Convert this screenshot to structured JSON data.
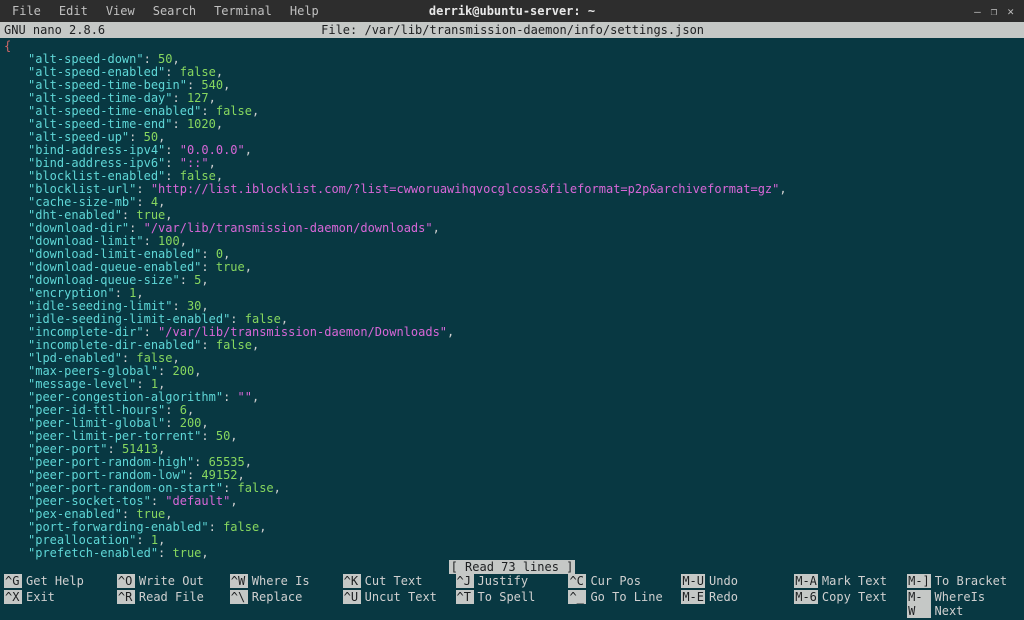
{
  "window": {
    "title": "derrik@ubuntu-server: ~",
    "menu": [
      "File",
      "Edit",
      "View",
      "Search",
      "Terminal",
      "Help"
    ]
  },
  "nano": {
    "app_title": "GNU nano 2.8.6",
    "file_label": "File: /var/lib/transmission-daemon/info/settings.json",
    "status": "[ Read 73 lines ]"
  },
  "json_lines": [
    {
      "k": "alt-speed-down",
      "t": "num",
      "v": "50"
    },
    {
      "k": "alt-speed-enabled",
      "t": "bool",
      "v": "false"
    },
    {
      "k": "alt-speed-time-begin",
      "t": "num",
      "v": "540"
    },
    {
      "k": "alt-speed-time-day",
      "t": "num",
      "v": "127"
    },
    {
      "k": "alt-speed-time-enabled",
      "t": "bool",
      "v": "false"
    },
    {
      "k": "alt-speed-time-end",
      "t": "num",
      "v": "1020"
    },
    {
      "k": "alt-speed-up",
      "t": "num",
      "v": "50"
    },
    {
      "k": "bind-address-ipv4",
      "t": "str",
      "v": "0.0.0.0"
    },
    {
      "k": "bind-address-ipv6",
      "t": "str",
      "v": "::"
    },
    {
      "k": "blocklist-enabled",
      "t": "bool",
      "v": "false"
    },
    {
      "k": "blocklist-url",
      "t": "str",
      "v": "http://list.iblocklist.com/?list=cwworuawihqvocglcoss&fileformat=p2p&archiveformat=gz"
    },
    {
      "k": "cache-size-mb",
      "t": "num",
      "v": "4"
    },
    {
      "k": "dht-enabled",
      "t": "bool",
      "v": "true"
    },
    {
      "k": "download-dir",
      "t": "str",
      "v": "/var/lib/transmission-daemon/downloads"
    },
    {
      "k": "download-limit",
      "t": "num",
      "v": "100"
    },
    {
      "k": "download-limit-enabled",
      "t": "num",
      "v": "0"
    },
    {
      "k": "download-queue-enabled",
      "t": "bool",
      "v": "true"
    },
    {
      "k": "download-queue-size",
      "t": "num",
      "v": "5"
    },
    {
      "k": "encryption",
      "t": "num",
      "v": "1"
    },
    {
      "k": "idle-seeding-limit",
      "t": "num",
      "v": "30"
    },
    {
      "k": "idle-seeding-limit-enabled",
      "t": "bool",
      "v": "false"
    },
    {
      "k": "incomplete-dir",
      "t": "str",
      "v": "/var/lib/transmission-daemon/Downloads"
    },
    {
      "k": "incomplete-dir-enabled",
      "t": "bool",
      "v": "false"
    },
    {
      "k": "lpd-enabled",
      "t": "bool",
      "v": "false"
    },
    {
      "k": "max-peers-global",
      "t": "num",
      "v": "200"
    },
    {
      "k": "message-level",
      "t": "num",
      "v": "1"
    },
    {
      "k": "peer-congestion-algorithm",
      "t": "str",
      "v": ""
    },
    {
      "k": "peer-id-ttl-hours",
      "t": "num",
      "v": "6"
    },
    {
      "k": "peer-limit-global",
      "t": "num",
      "v": "200"
    },
    {
      "k": "peer-limit-per-torrent",
      "t": "num",
      "v": "50"
    },
    {
      "k": "peer-port",
      "t": "num",
      "v": "51413"
    },
    {
      "k": "peer-port-random-high",
      "t": "num",
      "v": "65535"
    },
    {
      "k": "peer-port-random-low",
      "t": "num",
      "v": "49152"
    },
    {
      "k": "peer-port-random-on-start",
      "t": "bool",
      "v": "false"
    },
    {
      "k": "peer-socket-tos",
      "t": "str",
      "v": "default"
    },
    {
      "k": "pex-enabled",
      "t": "bool",
      "v": "true"
    },
    {
      "k": "port-forwarding-enabled",
      "t": "bool",
      "v": "false"
    },
    {
      "k": "preallocation",
      "t": "num",
      "v": "1"
    },
    {
      "k": "prefetch-enabled",
      "t": "bool",
      "v": "true"
    }
  ],
  "shortcuts": {
    "row1": [
      {
        "key": "^G",
        "label": "Get Help"
      },
      {
        "key": "^O",
        "label": "Write Out"
      },
      {
        "key": "^W",
        "label": "Where Is"
      },
      {
        "key": "^K",
        "label": "Cut Text"
      },
      {
        "key": "^J",
        "label": "Justify"
      },
      {
        "key": "^C",
        "label": "Cur Pos"
      },
      {
        "key": "M-U",
        "label": "Undo"
      },
      {
        "key": "M-A",
        "label": "Mark Text"
      },
      {
        "key": "M-]",
        "label": "To Bracket"
      }
    ],
    "row2": [
      {
        "key": "^X",
        "label": "Exit"
      },
      {
        "key": "^R",
        "label": "Read File"
      },
      {
        "key": "^\\",
        "label": "Replace"
      },
      {
        "key": "^U",
        "label": "Uncut Text"
      },
      {
        "key": "^T",
        "label": "To Spell"
      },
      {
        "key": "^_",
        "label": "Go To Line"
      },
      {
        "key": "M-E",
        "label": "Redo"
      },
      {
        "key": "M-6",
        "label": "Copy Text"
      },
      {
        "key": "M-W",
        "label": "WhereIs Next"
      }
    ]
  }
}
